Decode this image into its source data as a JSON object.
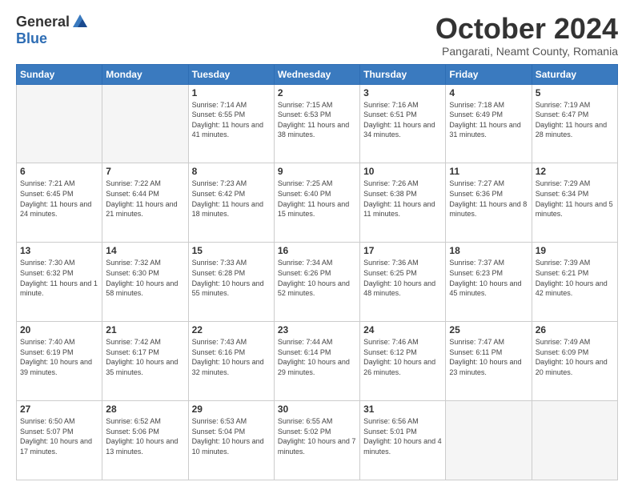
{
  "logo": {
    "general": "General",
    "blue": "Blue"
  },
  "header": {
    "month": "October 2024",
    "subtitle": "Pangarati, Neamt County, Romania"
  },
  "weekdays": [
    "Sunday",
    "Monday",
    "Tuesday",
    "Wednesday",
    "Thursday",
    "Friday",
    "Saturday"
  ],
  "weeks": [
    [
      {
        "day": "",
        "sunrise": "",
        "sunset": "",
        "daylight": ""
      },
      {
        "day": "",
        "sunrise": "",
        "sunset": "",
        "daylight": ""
      },
      {
        "day": "1",
        "sunrise": "Sunrise: 7:14 AM",
        "sunset": "Sunset: 6:55 PM",
        "daylight": "Daylight: 11 hours and 41 minutes."
      },
      {
        "day": "2",
        "sunrise": "Sunrise: 7:15 AM",
        "sunset": "Sunset: 6:53 PM",
        "daylight": "Daylight: 11 hours and 38 minutes."
      },
      {
        "day": "3",
        "sunrise": "Sunrise: 7:16 AM",
        "sunset": "Sunset: 6:51 PM",
        "daylight": "Daylight: 11 hours and 34 minutes."
      },
      {
        "day": "4",
        "sunrise": "Sunrise: 7:18 AM",
        "sunset": "Sunset: 6:49 PM",
        "daylight": "Daylight: 11 hours and 31 minutes."
      },
      {
        "day": "5",
        "sunrise": "Sunrise: 7:19 AM",
        "sunset": "Sunset: 6:47 PM",
        "daylight": "Daylight: 11 hours and 28 minutes."
      }
    ],
    [
      {
        "day": "6",
        "sunrise": "Sunrise: 7:21 AM",
        "sunset": "Sunset: 6:45 PM",
        "daylight": "Daylight: 11 hours and 24 minutes."
      },
      {
        "day": "7",
        "sunrise": "Sunrise: 7:22 AM",
        "sunset": "Sunset: 6:44 PM",
        "daylight": "Daylight: 11 hours and 21 minutes."
      },
      {
        "day": "8",
        "sunrise": "Sunrise: 7:23 AM",
        "sunset": "Sunset: 6:42 PM",
        "daylight": "Daylight: 11 hours and 18 minutes."
      },
      {
        "day": "9",
        "sunrise": "Sunrise: 7:25 AM",
        "sunset": "Sunset: 6:40 PM",
        "daylight": "Daylight: 11 hours and 15 minutes."
      },
      {
        "day": "10",
        "sunrise": "Sunrise: 7:26 AM",
        "sunset": "Sunset: 6:38 PM",
        "daylight": "Daylight: 11 hours and 11 minutes."
      },
      {
        "day": "11",
        "sunrise": "Sunrise: 7:27 AM",
        "sunset": "Sunset: 6:36 PM",
        "daylight": "Daylight: 11 hours and 8 minutes."
      },
      {
        "day": "12",
        "sunrise": "Sunrise: 7:29 AM",
        "sunset": "Sunset: 6:34 PM",
        "daylight": "Daylight: 11 hours and 5 minutes."
      }
    ],
    [
      {
        "day": "13",
        "sunrise": "Sunrise: 7:30 AM",
        "sunset": "Sunset: 6:32 PM",
        "daylight": "Daylight: 11 hours and 1 minute."
      },
      {
        "day": "14",
        "sunrise": "Sunrise: 7:32 AM",
        "sunset": "Sunset: 6:30 PM",
        "daylight": "Daylight: 10 hours and 58 minutes."
      },
      {
        "day": "15",
        "sunrise": "Sunrise: 7:33 AM",
        "sunset": "Sunset: 6:28 PM",
        "daylight": "Daylight: 10 hours and 55 minutes."
      },
      {
        "day": "16",
        "sunrise": "Sunrise: 7:34 AM",
        "sunset": "Sunset: 6:26 PM",
        "daylight": "Daylight: 10 hours and 52 minutes."
      },
      {
        "day": "17",
        "sunrise": "Sunrise: 7:36 AM",
        "sunset": "Sunset: 6:25 PM",
        "daylight": "Daylight: 10 hours and 48 minutes."
      },
      {
        "day": "18",
        "sunrise": "Sunrise: 7:37 AM",
        "sunset": "Sunset: 6:23 PM",
        "daylight": "Daylight: 10 hours and 45 minutes."
      },
      {
        "day": "19",
        "sunrise": "Sunrise: 7:39 AM",
        "sunset": "Sunset: 6:21 PM",
        "daylight": "Daylight: 10 hours and 42 minutes."
      }
    ],
    [
      {
        "day": "20",
        "sunrise": "Sunrise: 7:40 AM",
        "sunset": "Sunset: 6:19 PM",
        "daylight": "Daylight: 10 hours and 39 minutes."
      },
      {
        "day": "21",
        "sunrise": "Sunrise: 7:42 AM",
        "sunset": "Sunset: 6:17 PM",
        "daylight": "Daylight: 10 hours and 35 minutes."
      },
      {
        "day": "22",
        "sunrise": "Sunrise: 7:43 AM",
        "sunset": "Sunset: 6:16 PM",
        "daylight": "Daylight: 10 hours and 32 minutes."
      },
      {
        "day": "23",
        "sunrise": "Sunrise: 7:44 AM",
        "sunset": "Sunset: 6:14 PM",
        "daylight": "Daylight: 10 hours and 29 minutes."
      },
      {
        "day": "24",
        "sunrise": "Sunrise: 7:46 AM",
        "sunset": "Sunset: 6:12 PM",
        "daylight": "Daylight: 10 hours and 26 minutes."
      },
      {
        "day": "25",
        "sunrise": "Sunrise: 7:47 AM",
        "sunset": "Sunset: 6:11 PM",
        "daylight": "Daylight: 10 hours and 23 minutes."
      },
      {
        "day": "26",
        "sunrise": "Sunrise: 7:49 AM",
        "sunset": "Sunset: 6:09 PM",
        "daylight": "Daylight: 10 hours and 20 minutes."
      }
    ],
    [
      {
        "day": "27",
        "sunrise": "Sunrise: 6:50 AM",
        "sunset": "Sunset: 5:07 PM",
        "daylight": "Daylight: 10 hours and 17 minutes."
      },
      {
        "day": "28",
        "sunrise": "Sunrise: 6:52 AM",
        "sunset": "Sunset: 5:06 PM",
        "daylight": "Daylight: 10 hours and 13 minutes."
      },
      {
        "day": "29",
        "sunrise": "Sunrise: 6:53 AM",
        "sunset": "Sunset: 5:04 PM",
        "daylight": "Daylight: 10 hours and 10 minutes."
      },
      {
        "day": "30",
        "sunrise": "Sunrise: 6:55 AM",
        "sunset": "Sunset: 5:02 PM",
        "daylight": "Daylight: 10 hours and 7 minutes."
      },
      {
        "day": "31",
        "sunrise": "Sunrise: 6:56 AM",
        "sunset": "Sunset: 5:01 PM",
        "daylight": "Daylight: 10 hours and 4 minutes."
      },
      {
        "day": "",
        "sunrise": "",
        "sunset": "",
        "daylight": ""
      },
      {
        "day": "",
        "sunrise": "",
        "sunset": "",
        "daylight": ""
      }
    ]
  ]
}
